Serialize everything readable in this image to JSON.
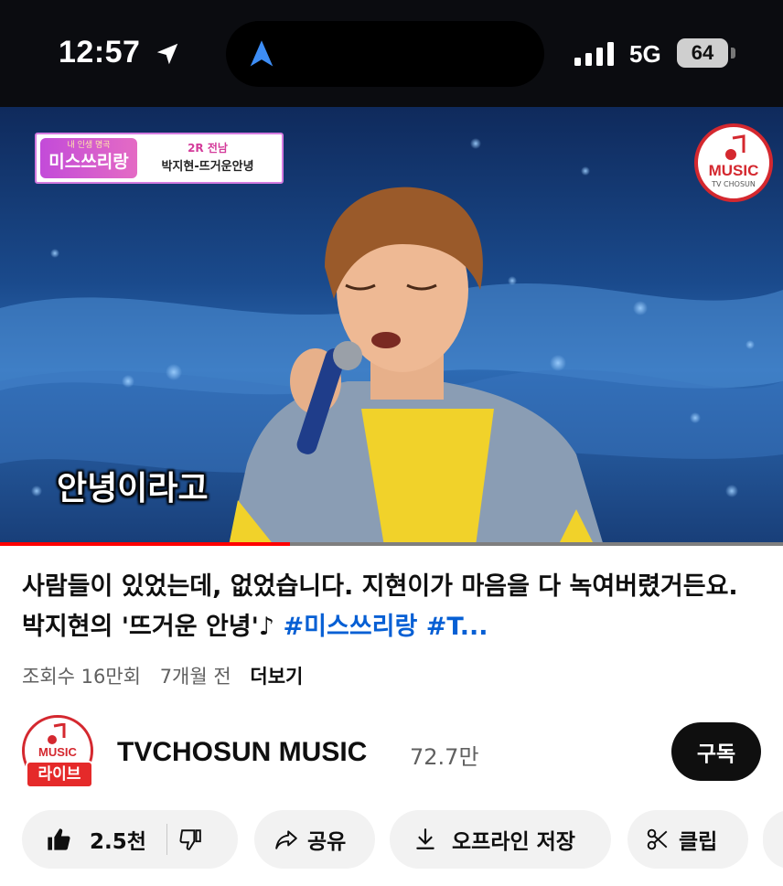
{
  "status_bar": {
    "time": "12:57",
    "network": "5G",
    "battery": "64"
  },
  "video": {
    "show_badge": {
      "logo_top": "내 인생 명곡",
      "logo": "미스쓰리랑",
      "round": "2R 전남",
      "song": "박지현-뜨거운안녕"
    },
    "channel_badge": {
      "label": "MUSIC",
      "sub": "TV CHOSUN"
    },
    "subtitle": "안녕이라고",
    "progress": 0.37
  },
  "info": {
    "title_text": "사람들이 있었는데, 없었습니다. 지현이가 마음을 다 녹여버렸거든요. 박지현의 '뜨거운 안녕'♪ ",
    "title_hashtags": "#미스쓰리랑 #T...",
    "views": "조회수 16만회",
    "age": "7개월 전",
    "more": "더보기"
  },
  "channel": {
    "avatar_label": "MUSIC",
    "live_label": "라이브",
    "name": "TVCHOSUN MUSIC",
    "subscribers": "72.7만",
    "subscribe_label": "구독"
  },
  "actions": {
    "likes": "2.5천",
    "share": "공유",
    "offline": "오프라인 저장",
    "clip": "클립"
  },
  "colors": {
    "accent_red": "#ff0000",
    "link_blue": "#065fd4",
    "brand_red": "#d4282f"
  }
}
